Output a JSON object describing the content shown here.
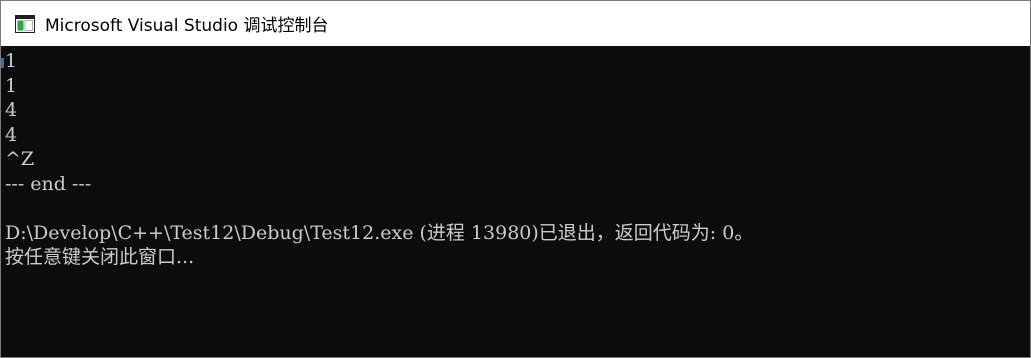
{
  "window": {
    "title": "Microsoft Visual Studio 调试控制台",
    "icon": "console-app-icon"
  },
  "console": {
    "lines": [
      "1",
      "1",
      "4",
      "4",
      "^Z",
      "--- end ---",
      "",
      "D:\\Develop\\C++\\Test12\\Debug\\Test12.exe (进程 13980)已退出，返回代码为: 0。",
      "按任意键关闭此窗口..."
    ],
    "background_color": "#0c0c0c",
    "text_color": "#cccccc"
  }
}
